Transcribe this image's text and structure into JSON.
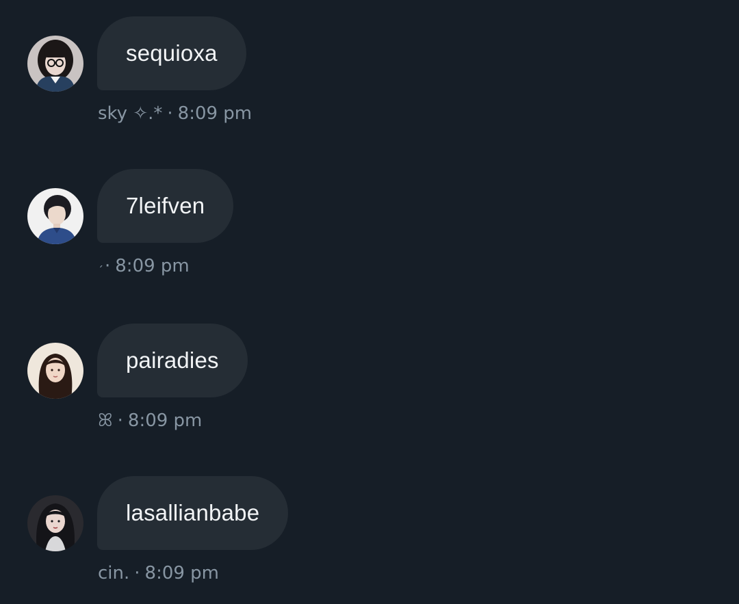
{
  "messages": [
    {
      "text": "sequioxa",
      "sender": "sky ✧.*",
      "separator": "·",
      "time": "8:09 pm",
      "avatar_icon": "avatar-glasses-girl",
      "avatar_colors": {
        "bg": "#c9c3c2",
        "hair": "#1b1717",
        "face": "#e9d7cf",
        "clothes": "#27405f"
      }
    },
    {
      "text": "7leifven",
      "sender": "ˏ",
      "separator": "·",
      "time": "8:09 pm",
      "avatar_icon": "avatar-boy-blue-shirt",
      "avatar_colors": {
        "bg": "#f1f1f1",
        "hair": "#1c1c22",
        "face": "#ecd9cc",
        "clothes": "#2e4d8a"
      }
    },
    {
      "text": "pairadies",
      "sender": "ꕤ",
      "separator": "·",
      "time": "8:09 pm",
      "avatar_icon": "avatar-long-hair-girl",
      "avatar_colors": {
        "bg": "#efe7dc",
        "hair": "#2a1a14",
        "face": "#f0d7c6",
        "clothes": "#efe7dc"
      }
    },
    {
      "text": "lasallianbabe",
      "sender": "cin.",
      "separator": "·",
      "time": "8:09 pm",
      "avatar_icon": "avatar-dark-hair-girl",
      "avatar_colors": {
        "bg": "#2a2a2f",
        "hair": "#141418",
        "face": "#ead6cf",
        "clothes": "#d8d8da"
      }
    }
  ]
}
